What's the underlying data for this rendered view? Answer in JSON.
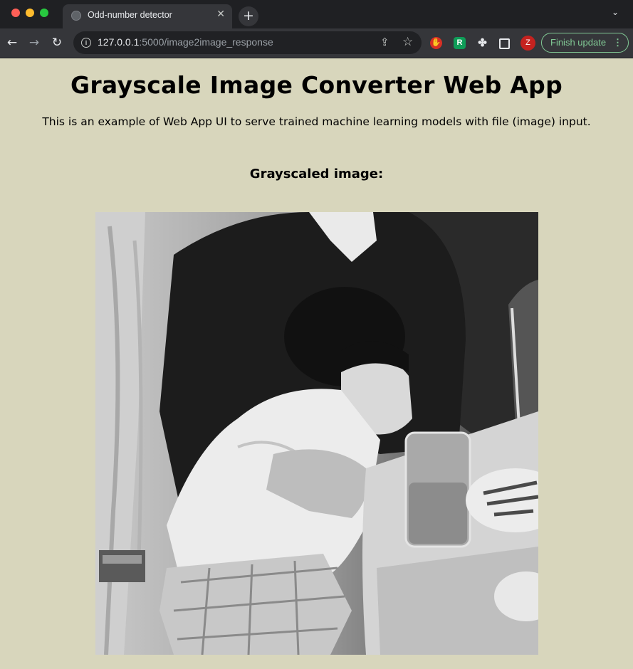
{
  "browser": {
    "tab_title": "Odd-number detector",
    "new_tab_symbol": "+",
    "url_host": "127.0.0.1",
    "url_rest": ":5000/image2image_response",
    "profile_initial": "Z",
    "update_button": "Finish update",
    "extension_r_label": "R"
  },
  "page": {
    "title": "Grayscale Image Converter Web App",
    "description": "This is an example of Web App UI to serve trained machine learning models with file (image) input.",
    "result_heading": "Grayscaled image:"
  },
  "image": {
    "alt": "Grayscale photo of a small child seated on an adult's lap at a table with a glass and plates"
  },
  "colors": {
    "page_background": "#d8d6bc",
    "update_accent": "#81c995"
  }
}
